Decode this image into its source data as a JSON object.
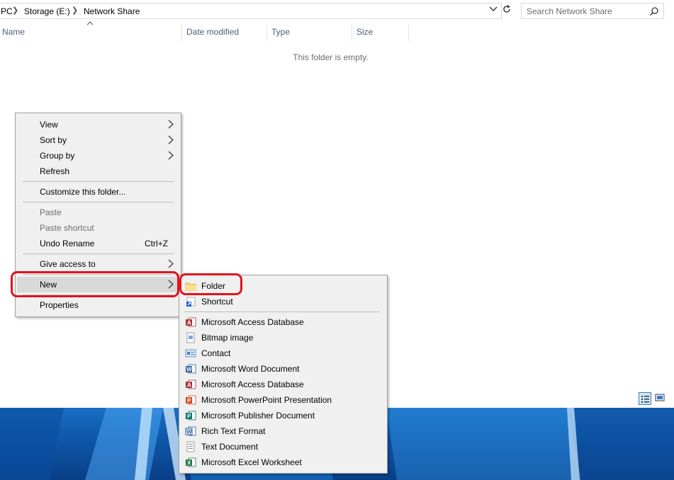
{
  "address_bar": {
    "path": [
      "PC",
      "Storage (E:)",
      "Network Share"
    ]
  },
  "search": {
    "placeholder": "Search Network Share"
  },
  "columns": [
    "Name",
    "Date modified",
    "Type",
    "Size"
  ],
  "empty_message": "This folder is empty.",
  "context_menu": {
    "items": [
      {
        "label": "View",
        "submenu": true
      },
      {
        "label": "Sort by",
        "submenu": true
      },
      {
        "label": "Group by",
        "submenu": true
      },
      {
        "label": "Refresh"
      },
      {
        "label": "Customize this folder..."
      },
      {
        "label": "Paste",
        "disabled": true
      },
      {
        "label": "Paste shortcut",
        "disabled": true
      },
      {
        "label": "Undo Rename",
        "shortcut": "Ctrl+Z"
      },
      {
        "label": "Give access to",
        "submenu": true
      },
      {
        "label": "New",
        "submenu": true,
        "highlighted": true
      },
      {
        "label": "Properties"
      }
    ]
  },
  "new_submenu": {
    "items": [
      {
        "label": "Folder",
        "icon": "folder-icon"
      },
      {
        "label": "Shortcut",
        "icon": "shortcut-icon"
      },
      {
        "label": "Microsoft Access Database",
        "icon": "access-icon"
      },
      {
        "label": "Bitmap image",
        "icon": "bitmap-icon"
      },
      {
        "label": "Contact",
        "icon": "contact-icon"
      },
      {
        "label": "Microsoft Word Document",
        "icon": "word-icon"
      },
      {
        "label": "Microsoft Access Database",
        "icon": "access-icon"
      },
      {
        "label": "Microsoft PowerPoint Presentation",
        "icon": "powerpoint-icon"
      },
      {
        "label": "Microsoft Publisher Document",
        "icon": "publisher-icon"
      },
      {
        "label": "Rich Text Format",
        "icon": "rtf-icon"
      },
      {
        "label": "Text Document",
        "icon": "text-icon"
      },
      {
        "label": "Microsoft Excel Worksheet",
        "icon": "excel-icon"
      }
    ]
  },
  "colors": {
    "annotation": "#e0141e",
    "column_header_text": "#4c607a",
    "menu_background": "#f0f0f0",
    "desktop_blue": "#0d56a8"
  }
}
